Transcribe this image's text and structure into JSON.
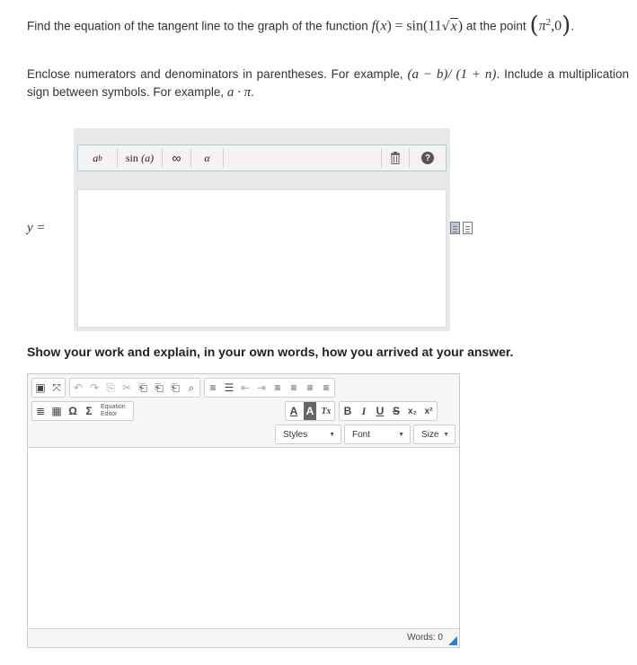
{
  "question": {
    "text_prefix": "Find the equation of the tangent line to the graph of the function",
    "func_f": "f",
    "func_lp": "(",
    "func_x": "x",
    "func_rp": ")",
    "func_eq": "=",
    "func_sin": "sin",
    "func_open": "(11",
    "func_rad": "√",
    "func_radicand": "x",
    "func_close": ")",
    "text_at": "at the point",
    "point_open": "(",
    "point_pi": "π",
    "point_exp": "2",
    "point_rest": ",0",
    "point_close": ")",
    "period": "."
  },
  "instructions": {
    "line_a": "Enclose numerators and denominators in parentheses. For example,",
    "example1": "(a − b)/ (1 + n)",
    "line_b": ". Include a multiplication sign between symbols. For example,",
    "example2": "a · π",
    "period": "."
  },
  "answer": {
    "y_label": "y ="
  },
  "math_toolbar": {
    "power_base": "a",
    "power_exp": "b",
    "sin_label": "sin",
    "sin_arg": "(a)",
    "infinity": "∞",
    "alpha": "α",
    "help": "?"
  },
  "work_prompt": "Show your work and explain, in your own words, how you arrived at your answer.",
  "rte": {
    "row1_group1": [
      "▣",
      "⤧"
    ],
    "row1_group2": [
      "↶",
      "↷"
    ],
    "row1_group3": [
      "⎘",
      "✂",
      "⎗",
      "⎗",
      "⎗"
    ],
    "find": "⌕",
    "row1_group4": [
      "≡",
      "☰",
      "⇤",
      "⇥"
    ],
    "row1_align": [
      "≡",
      "≡",
      "≡",
      "≡"
    ],
    "row2_group1": [
      "≣",
      "▦",
      "Ω",
      "Σ"
    ],
    "equation_editor": "Equation Editor",
    "textcolor": "A",
    "bgcolor": "A",
    "clearformat": "Tx",
    "bold": "B",
    "italic": "I",
    "underline": "U",
    "strike": "S",
    "subscript": "x₂",
    "superscript": "x²",
    "styles_label": "Styles",
    "font_label": "Font",
    "size_label": "Size",
    "word_count": "Words: 0"
  },
  "colors": {
    "toolbar_border": "#a9cee0",
    "resize_handle": "#2b7bd9",
    "editor_bg": "#e8e8e8"
  }
}
